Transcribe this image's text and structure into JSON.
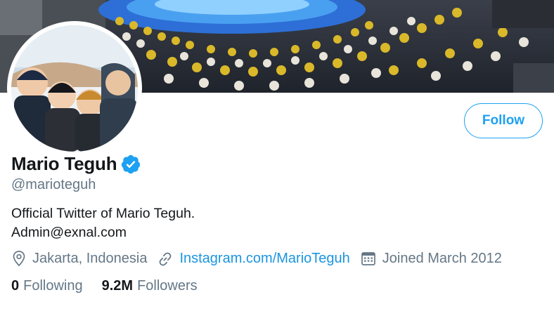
{
  "profile": {
    "display_name": "Mario Teguh",
    "handle": "@marioteguh",
    "bio_line1": "Official Twitter of Mario Teguh.",
    "bio_line2": "Admin@exnal.com",
    "location": "Jakarta, Indonesia",
    "website": "Instagram.com/MarioTeguh",
    "joined": "Joined March 2012"
  },
  "actions": {
    "follow_label": "Follow"
  },
  "stats": {
    "following_count": "0",
    "following_label": "Following",
    "followers_count": "9.2M",
    "followers_label": "Followers"
  },
  "colors": {
    "accent": "#1da1f2",
    "link": "#1b95e0",
    "text_primary": "#14171a",
    "text_secondary": "#657786"
  },
  "icons": {
    "verified": "verified-badge-icon",
    "location": "location-pin-icon",
    "website": "link-icon",
    "joined": "calendar-icon"
  }
}
